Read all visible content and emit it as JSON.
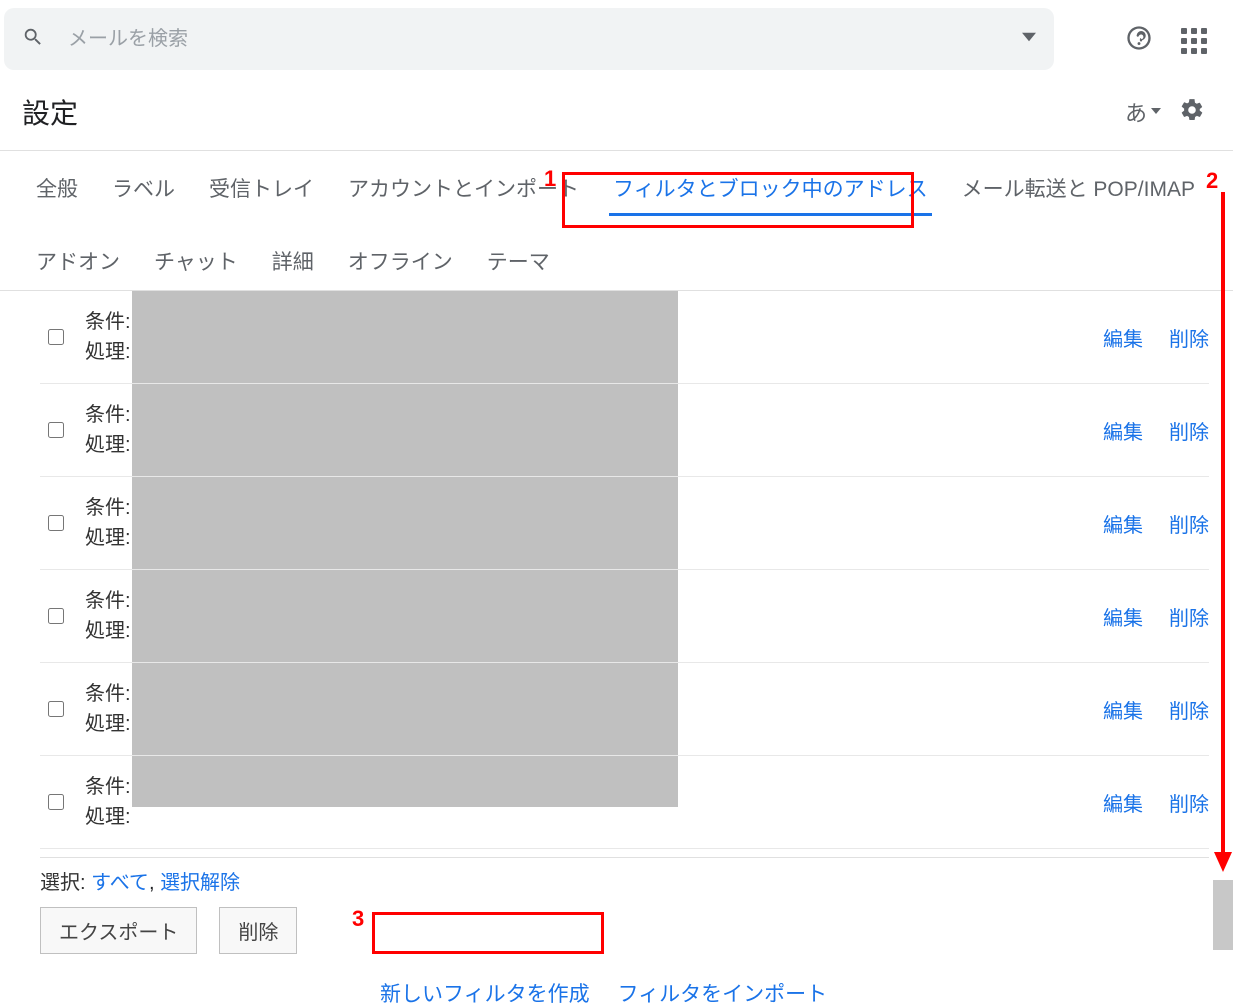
{
  "search": {
    "placeholder": "メールを検索"
  },
  "page_title": "設定",
  "language_indicator": "あ",
  "tabs": [
    {
      "label": "全般"
    },
    {
      "label": "ラベル"
    },
    {
      "label": "受信トレイ"
    },
    {
      "label": "アカウントとインポート"
    },
    {
      "label": "フィルタとブロック中のアドレス",
      "active": true
    },
    {
      "label": "メール転送と POP/IMAP"
    },
    {
      "label": "アドオン"
    },
    {
      "label": "チャット"
    },
    {
      "label": "詳細"
    },
    {
      "label": "オフライン"
    },
    {
      "label": "テーマ"
    }
  ],
  "filter_labels": {
    "condition": "条件:",
    "action": "処理:"
  },
  "filter_row_actions": {
    "edit": "編集",
    "delete": "削除"
  },
  "filters_count": 6,
  "selection": {
    "label": "選択:",
    "all": "すべて",
    "separator": ",",
    "none": "選択解除"
  },
  "buttons": {
    "export": "エクスポート",
    "delete": "削除"
  },
  "create_links": {
    "create": "新しいフィルタを作成",
    "import": "フィルタをインポート"
  },
  "annotations": {
    "n1": "1",
    "n2": "2",
    "n3": "3"
  }
}
